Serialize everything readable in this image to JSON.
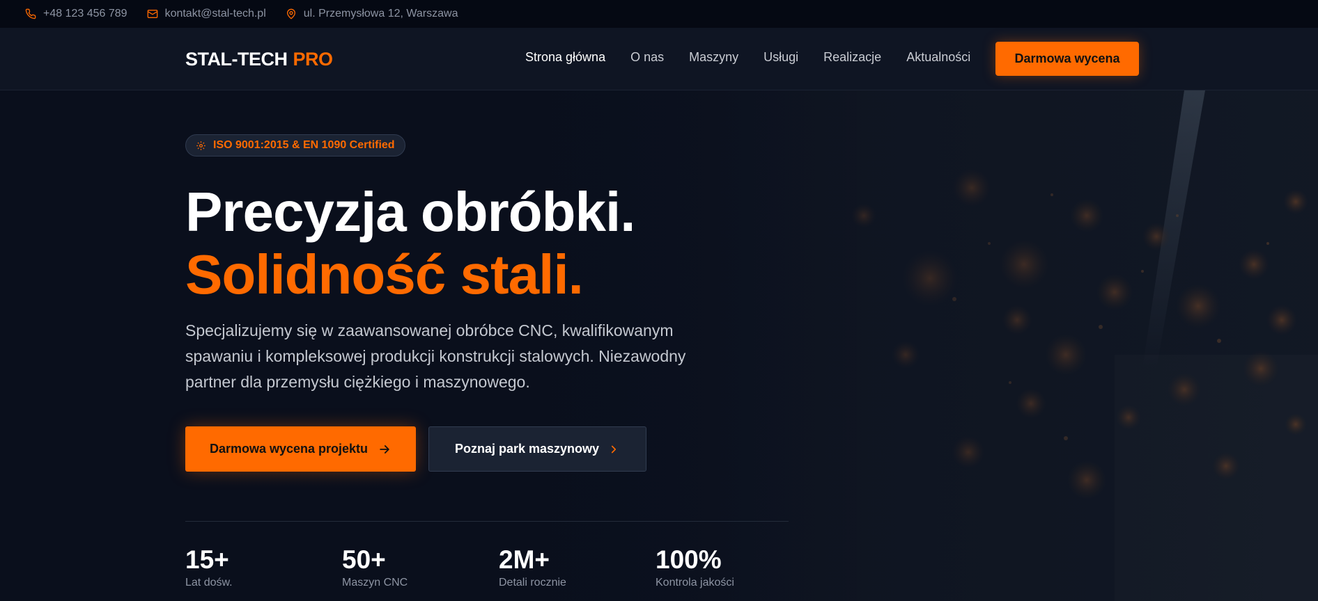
{
  "topbar": {
    "phone": "+48 123 456 789",
    "email": "kontakt@stal-tech.pl",
    "address": "ul. Przemysłowa 12, Warszawa"
  },
  "header": {
    "logo_main": "STAL-TECH",
    "logo_accent": "PRO",
    "nav": [
      "Strona główna",
      "O nas",
      "Maszyny",
      "Usługi",
      "Realizacje",
      "Aktualności"
    ],
    "cta_label": "Darmowa wycena"
  },
  "hero": {
    "badge": "ISO 9001:2015 & EN 1090 Certified",
    "headline_line1": "Precyzja obróbki.",
    "headline_line2": "Solidność stali.",
    "lead": "Specjalizujemy się w zaawansowanej obróbce CNC, kwalifikowanym spawaniu i kompleksowej produkcji konstrukcji stalowych. Niezawodny partner dla przemysłu ciężkiego i maszynowego.",
    "primary_button": "Darmowa wycena projektu",
    "secondary_button": "Poznaj park maszynowy",
    "stats": [
      {
        "value": "15+",
        "label": "Lat dośw."
      },
      {
        "value": "50+",
        "label": "Maszyn CNC"
      },
      {
        "value": "2M+",
        "label": "Detali rocznie"
      },
      {
        "value": "100%",
        "label": "Kontrola jakości"
      }
    ]
  },
  "colors": {
    "accent": "#ff6a00",
    "background": "#0a0f1c",
    "header_bg": "#0f1523"
  },
  "icons": {
    "phone": "phone-icon",
    "email": "mail-icon",
    "address": "map-pin-icon",
    "badge": "gear-icon",
    "primary_button": "arrow-right-icon",
    "secondary_button": "chevron-right-icon"
  }
}
